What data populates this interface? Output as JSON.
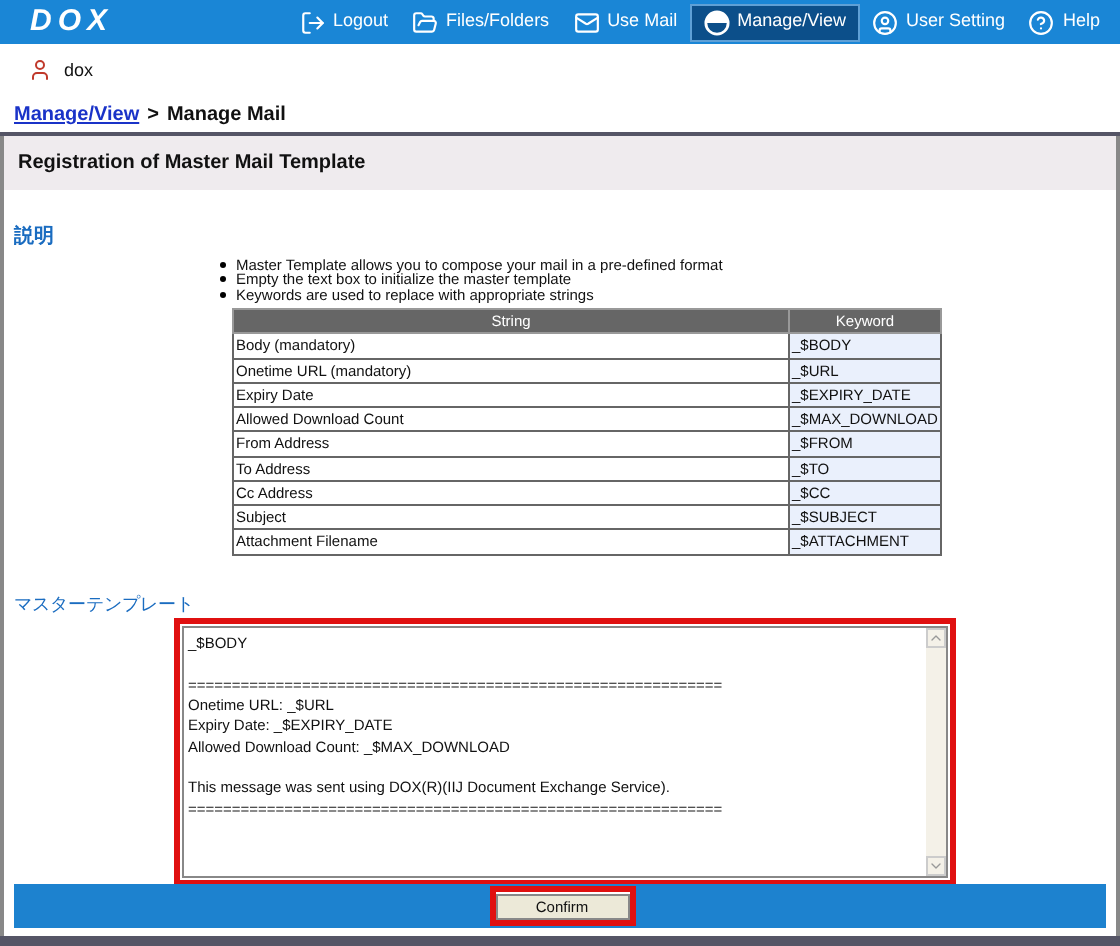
{
  "logo": "DOX",
  "nav": [
    {
      "label": "Logout",
      "kind": "logout",
      "selected": false
    },
    {
      "label": "Files/Folders",
      "kind": "files",
      "selected": false
    },
    {
      "label": "Use Mail",
      "kind": "mail",
      "selected": false
    },
    {
      "label": "Manage/View",
      "kind": "manage",
      "selected": true
    },
    {
      "label": "User Setting",
      "kind": "user",
      "selected": false
    },
    {
      "label": "Help",
      "kind": "help",
      "selected": false
    }
  ],
  "user": "dox",
  "breadcrumb": {
    "link": "Manage/View",
    "separator": ">",
    "current": "Manage Mail"
  },
  "page_title": "Registration of Master Mail Template",
  "description": {
    "heading": "説明",
    "bullets": [
      "Master Template allows you to compose your mail in a pre-defined format",
      "Empty the text box to initialize the master template",
      "Keywords are used to replace with appropriate strings"
    ]
  },
  "table": {
    "columns": [
      "String",
      "Keyword"
    ],
    "rows": [
      [
        "Body (mandatory)",
        "_$BODY"
      ],
      [
        "Onetime URL (mandatory)",
        "_$URL"
      ],
      [
        "Expiry Date",
        "_$EXPIRY_DATE"
      ],
      [
        "Allowed Download Count",
        "_$MAX_DOWNLOAD"
      ],
      [
        "From Address",
        "_$FROM"
      ],
      [
        "To Address",
        "_$TO"
      ],
      [
        "Cc Address",
        "_$CC"
      ],
      [
        "Subject",
        "_$SUBJECT"
      ],
      [
        "Attachment Filename",
        "_$ATTACHMENT"
      ]
    ]
  },
  "template": {
    "heading": "マスターテンプレート",
    "lines": [
      {
        "kind": "text",
        "text": "_$BODY"
      },
      {
        "kind": "blank"
      },
      {
        "kind": "text",
        "text": "============================================================="
      },
      {
        "kind": "text",
        "text": "Onetime URL: _$URL"
      },
      {
        "kind": "text",
        "text": "Expiry Date: _$EXPIRY_DATE"
      },
      {
        "kind": "text",
        "text": "Allowed Download Count: _$MAX_DOWNLOAD"
      },
      {
        "kind": "blank"
      },
      {
        "kind": "text",
        "text": "This message was sent using DOX(R)(IIJ Document Exchange Service)."
      },
      {
        "kind": "text",
        "text": "============================================================="
      }
    ]
  },
  "confirm_button": "Confirm"
}
